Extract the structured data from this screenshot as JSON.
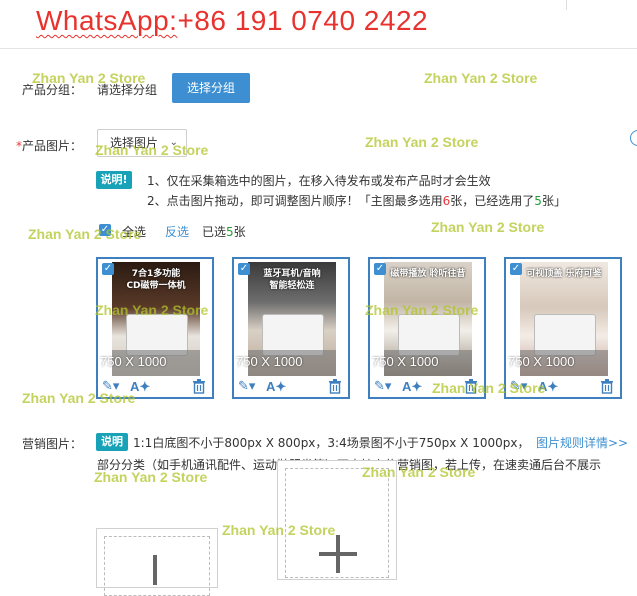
{
  "banner": {
    "whatsapp_label": "WhatsApp:",
    "phone": "+86 191 0740 2422"
  },
  "watermark": "Zhan Yan 2 Store",
  "group": {
    "label": "产品分组：",
    "placeholder": "请选择分组",
    "button": "选择分组"
  },
  "images": {
    "required_mark": "*",
    "label": "产品图片：",
    "select_label": "选择图片",
    "help_badge": "i",
    "note_tag": "说明!",
    "note_line1": "1、仅在采集箱选中的图片，在移入待发布或发布产品时才会生效",
    "note_line2_a": "2、点击图片拖动，即可调整图片顺序！「主图最多选用",
    "note_line2_max": "6",
    "note_line2_b": "张，已经选用了",
    "note_line2_used": "5",
    "note_line2_c": "张」",
    "select_all": "全选",
    "invert": "反选",
    "selected_prefix": "已选",
    "selected_count": "5",
    "selected_suffix": "张",
    "cards": [
      {
        "dims": "750 X 1000",
        "caption_line1": "7合1多功能",
        "caption_line2": "CD磁带一体机"
      },
      {
        "dims": "750 X 1000",
        "caption_line1": "蓝牙耳机/音响",
        "caption_line2": "智能轻松连"
      },
      {
        "dims": "750 X 1000",
        "caption_line1": "磁带播放 聆听往昔",
        "caption_line2": ""
      },
      {
        "dims": "750 X 1000",
        "caption_line1": "可视顶盖 乐府可鉴",
        "caption_line2": ""
      }
    ]
  },
  "marketing": {
    "label": "营销图片：",
    "note_tag": "说明",
    "note_line1": "1:1白底图不小于800px X 800px，3:4场景图不小于750px X 1000px，",
    "rules_link": "图片规则详情>>",
    "note_line2": "部分分类（如手机通讯配件、运动鞋服类等）不支持上传营销图，若上传，在速卖通后台不展示"
  },
  "colors": {
    "primary": "#3d8fd1",
    "card_border": "#3d7fbf",
    "required": "#e4393c",
    "count_red": "#e4393c",
    "count_green": "#22a033",
    "note_tag": "#17a2b8",
    "banner": "#e8322e"
  }
}
